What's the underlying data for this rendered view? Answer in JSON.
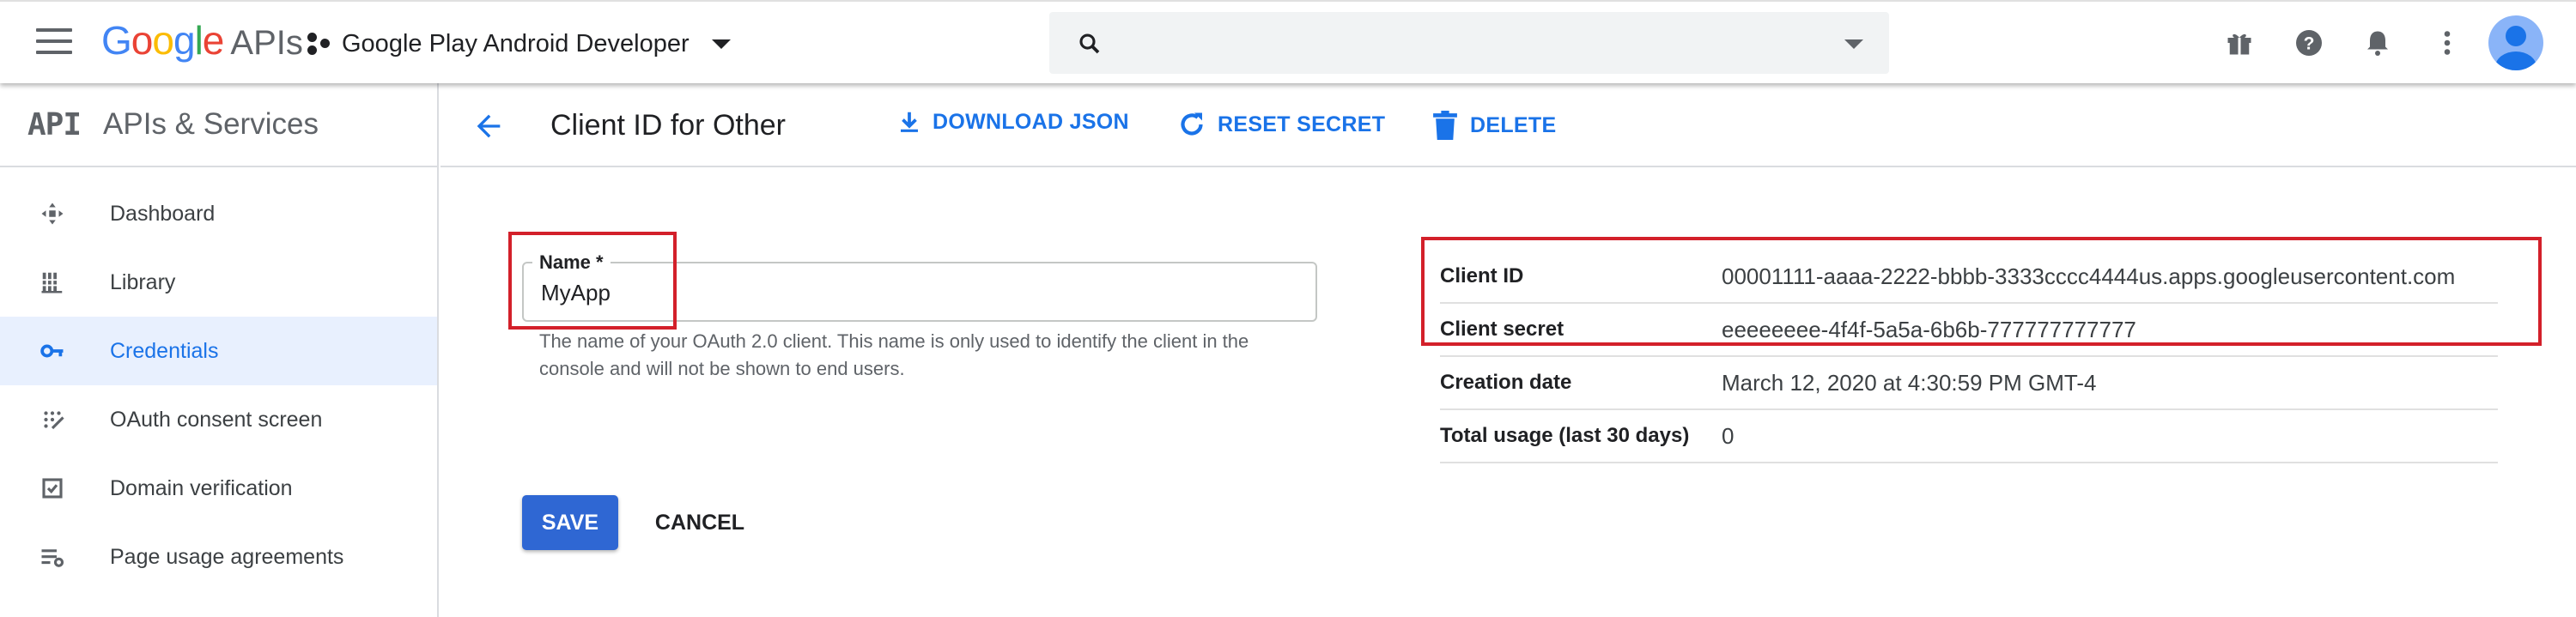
{
  "topbar": {
    "logo_google": [
      "G",
      "o",
      "o",
      "g",
      "l",
      "e"
    ],
    "logo_google_colors": [
      "#4285F4",
      "#EA4335",
      "#FBBC05",
      "#4285F4",
      "#34A853",
      "#EA4335"
    ],
    "logo_apis": "APIs",
    "project_name": "Google Play Android Developer",
    "search": {
      "value": "",
      "placeholder": ""
    },
    "icons": [
      "menu-icon",
      "gift-icon",
      "help-icon",
      "notifications-icon",
      "more-vert-icon",
      "account-avatar"
    ]
  },
  "sidebar": {
    "badge": "API",
    "title": "APIs & Services",
    "items": [
      {
        "label": "Dashboard",
        "icon": "dashboard-icon",
        "active": false
      },
      {
        "label": "Library",
        "icon": "library-icon",
        "active": false
      },
      {
        "label": "Credentials",
        "icon": "key-icon",
        "active": true
      },
      {
        "label": "OAuth consent screen",
        "icon": "consent-icon",
        "active": false
      },
      {
        "label": "Domain verification",
        "icon": "domain-check-icon",
        "active": false
      },
      {
        "label": "Page usage agreements",
        "icon": "settings-list-icon",
        "active": false
      }
    ]
  },
  "header": {
    "title": "Client ID for Other",
    "download": "DOWNLOAD JSON",
    "reset": "RESET SECRET",
    "delete": "DELETE"
  },
  "form": {
    "name_label": "Name *",
    "name_value": "MyApp",
    "hint": "The name of your OAuth 2.0 client. This name is only used to identify the client in the console and will not be shown to end users.",
    "save": "SAVE",
    "cancel": "CANCEL"
  },
  "info": [
    {
      "key": "Client ID",
      "value": "00001111-aaaa-2222-bbbb-3333cccc4444us.apps.googleusercontent.com"
    },
    {
      "key": "Client secret",
      "value": "eeeeeeee-4f4f-5a5a-6b6b-777777777777"
    },
    {
      "key": "Creation date",
      "value": "March 12, 2020 at 4:30:59 PM GMT-4"
    },
    {
      "key": "Total usage (last 30 days)",
      "value": "0"
    }
  ],
  "colors": {
    "accent": "#1a73e8",
    "highlight": "#d3202a",
    "active_bg": "#e8f0fe",
    "save_bg": "#2f67d3"
  }
}
